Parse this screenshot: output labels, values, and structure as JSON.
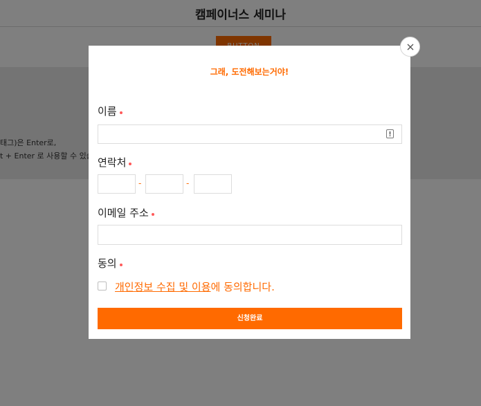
{
  "background": {
    "page_title": "캠페이너스 세미나",
    "button_label": "BUTTON",
    "text_line1": "태그)은 Enter로,",
    "text_line2": "t + Enter 로 사용할 수 있습"
  },
  "modal": {
    "headline": "그래, 도전해보는거야!",
    "fields": {
      "name_label": "이름",
      "phone_label": "연락처",
      "phone_separator": "-",
      "email_label": "이메일 주소",
      "consent_label": "동의"
    },
    "consent": {
      "link_text": "개인정보 수집 및 이용",
      "suffix_text": "에 동의합니다."
    },
    "submit_label": "신청완료"
  },
  "colors": {
    "accent": "#ff6a00",
    "required_dot": "#ff5a5a",
    "overlay": "rgba(0,0,0,0.5)"
  },
  "icons": {
    "close": "close-icon",
    "name_autofill": "id-card-icon"
  }
}
